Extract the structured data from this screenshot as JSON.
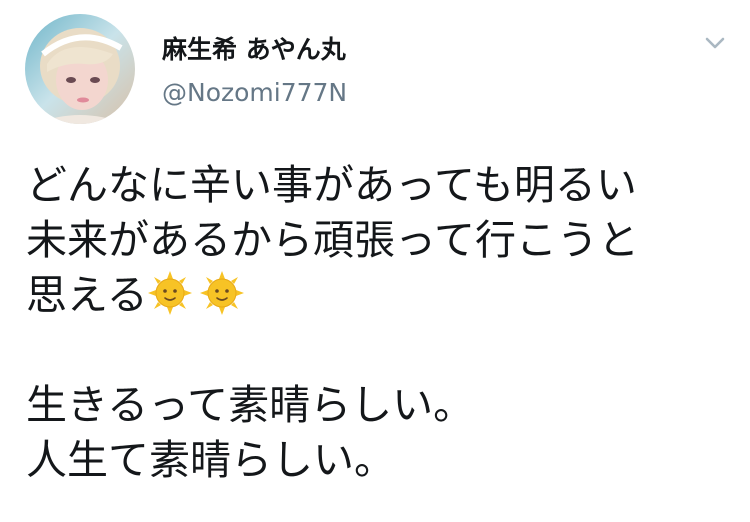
{
  "tweet": {
    "author": {
      "display_name": "麻生希 あやん丸",
      "handle": "@Nozomi777N"
    },
    "text_lines": [
      "どんなに辛い事があっても明るい",
      "未来があるから頑張って行こうと",
      "思える",
      "生きるって素晴らしい。",
      "人生て素晴らしい。"
    ],
    "emoji": [
      "sun-with-face-icon",
      "sun-with-face-icon"
    ]
  },
  "colors": {
    "text": "#14171a",
    "secondary": "#657786",
    "chevron": "#aab8c2",
    "sun": "#f7c325"
  }
}
